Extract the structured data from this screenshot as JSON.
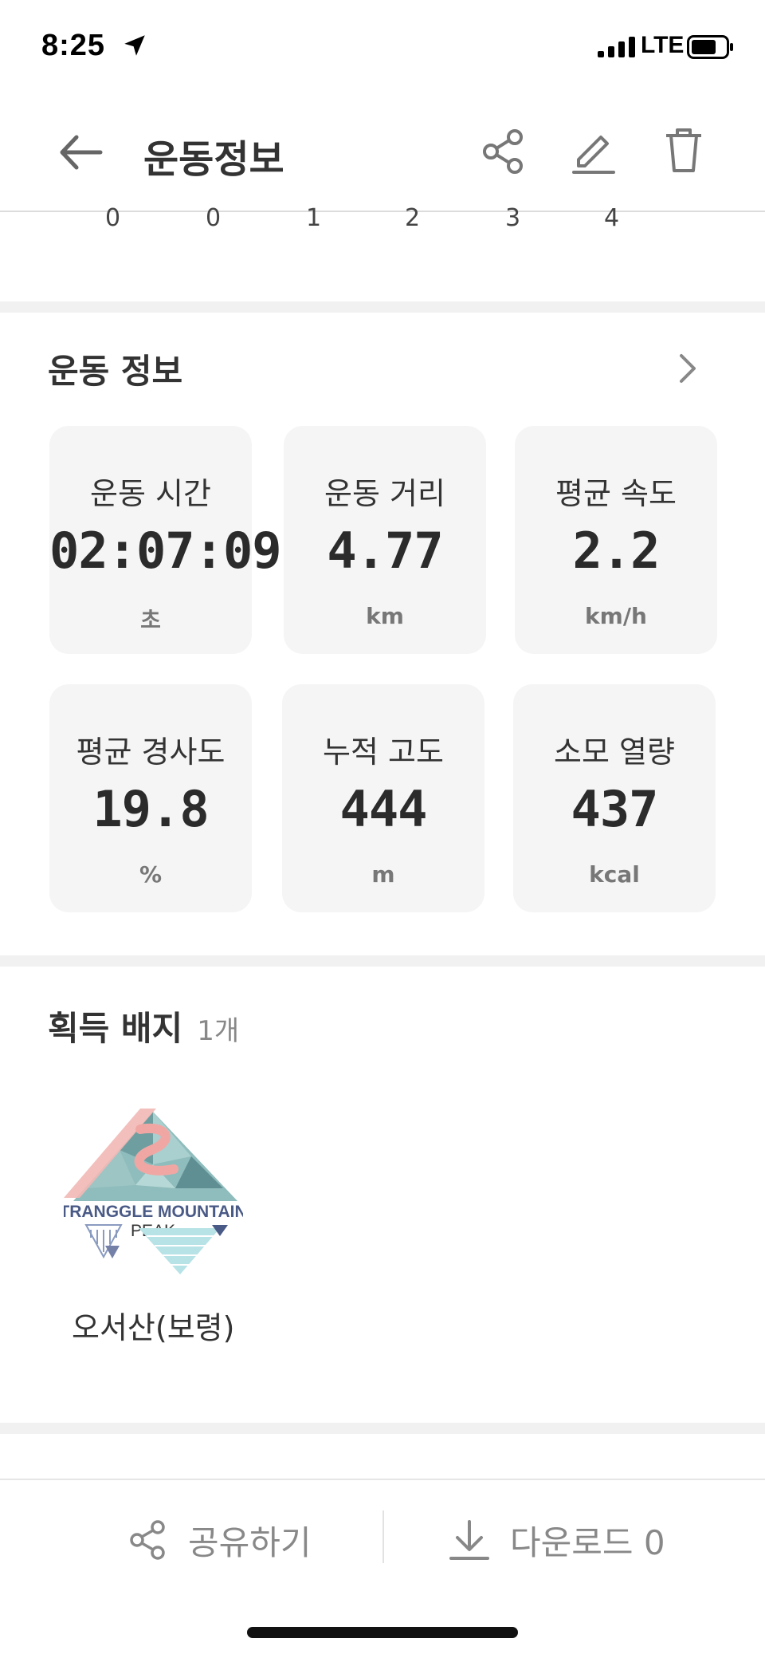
{
  "status_bar": {
    "time": "8:25",
    "network": "LTE"
  },
  "header": {
    "title": "운동정보"
  },
  "chart_axis": {
    "ticks": [
      "0",
      "0",
      "1",
      "2",
      "3",
      "4"
    ]
  },
  "workout_info": {
    "title": "운동 정보",
    "stats": [
      {
        "label": "운동 시간",
        "value": "02:07:09",
        "unit": "초"
      },
      {
        "label": "운동 거리",
        "value": "4.77",
        "unit": "km"
      },
      {
        "label": "평균 속도",
        "value": "2.2",
        "unit": "km/h"
      },
      {
        "label": "평균 경사도",
        "value": "19.8",
        "unit": "%"
      },
      {
        "label": "누적 고도",
        "value": "444",
        "unit": "m"
      },
      {
        "label": "소모 열량",
        "value": "437",
        "unit": "kcal"
      }
    ]
  },
  "badges": {
    "title": "획득 배지",
    "count": "1개",
    "items": [
      {
        "logo_line1": "TRANGGLE MOUNTAIN",
        "logo_line2": "PEAK",
        "name": "오서산(보령)"
      }
    ]
  },
  "bottom_bar": {
    "share_label": "공유하기",
    "download_label": "다운로드 0"
  },
  "colors": {
    "card_bg": "#f5f5f5",
    "divider": "#f1f1f1",
    "badge_teal": "#7fb3b5",
    "badge_pink": "#f2b8b5",
    "badge_navy": "#4a5a86"
  }
}
